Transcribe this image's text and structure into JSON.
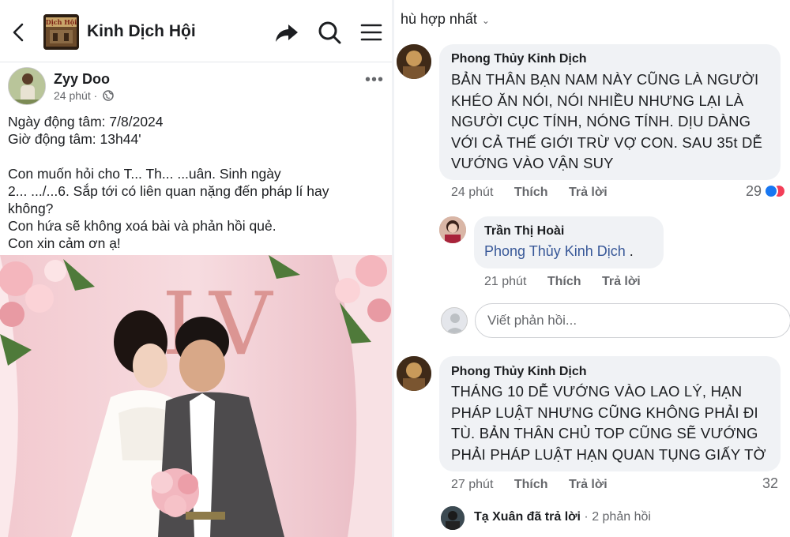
{
  "left": {
    "header": {
      "page_title": "Kinh Dịch Hội",
      "logo_text": "Dịch Hội"
    },
    "post": {
      "author": "Zyy Doo",
      "time": "24 phút ·",
      "more": "•••",
      "lines": [
        "Ngày động tâm: 7/8/2024",
        "Giờ động tâm: 13h44'",
        "",
        "Con muốn hỏi cho T... Th... ...uân. Sinh ngày",
        "2... .../...6. Sắp tới có liên quan nặng đến pháp lí hay",
        "không?",
        "Con hứa sẽ không xoá bài và phản hồi quẻ.",
        "Con xin cảm ơn ạ!"
      ],
      "photo_letters": "LV"
    }
  },
  "right": {
    "sort_label": "hù hợp nhất",
    "comments": [
      {
        "author": "Phong Thủy Kinh Dịch",
        "text_lines": [
          "BẢN THÂN BẠN NAM NÀY CŨNG LÀ NGƯỜI",
          "KHÉO ĂN NÓI, NÓI NHIỀU NHƯNG LẠI LÀ",
          "NGƯỜI CỤC TÍNH, NÓNG TÍNH. DỊU DÀNG",
          "VỚI CẢ THẾ GIỚI TRỪ VỢ CON. SAU 35t DỄ",
          "VƯỚNG VÀO VẬN SUY"
        ],
        "time": "24 phút",
        "like": "Thích",
        "reply": "Trả lời",
        "reactions": "29"
      },
      {
        "author": "Trần Thị Hoài",
        "mention": "Phong Thủy Kinh Dịch",
        "after_mention": " .",
        "time": "21 phút",
        "like": "Thích",
        "reply": "Trả lời"
      },
      {
        "author": "Phong Thủy Kinh Dịch",
        "text_lines": [
          "THÁNG 10 DỄ VƯỚNG VÀO LAO LÝ, HẠN",
          "PHÁP LUẬT NHƯNG CŨNG KHÔNG PHẢI ĐI",
          "TÙ. BẢN THÂN CHỦ TOP CŨNG SẼ VƯỚNG",
          "PHẢI PHÁP LUẬT HẠN QUAN TỤNG GIẤY TỜ"
        ],
        "time": "27 phút",
        "like": "Thích",
        "reply": "Trả lời",
        "reactions": "32"
      }
    ],
    "reply_placeholder": "Viết phản hồi...",
    "replies_summary": {
      "name": "Tạ Xuân",
      "action": " đã trả lời",
      "count": " · 2 phản hồi"
    }
  },
  "colors": {
    "accent_blue": "#1877f2",
    "bubble_gray": "#f0f2f5",
    "meta_gray": "#65676b",
    "mention_blue": "#385898"
  }
}
